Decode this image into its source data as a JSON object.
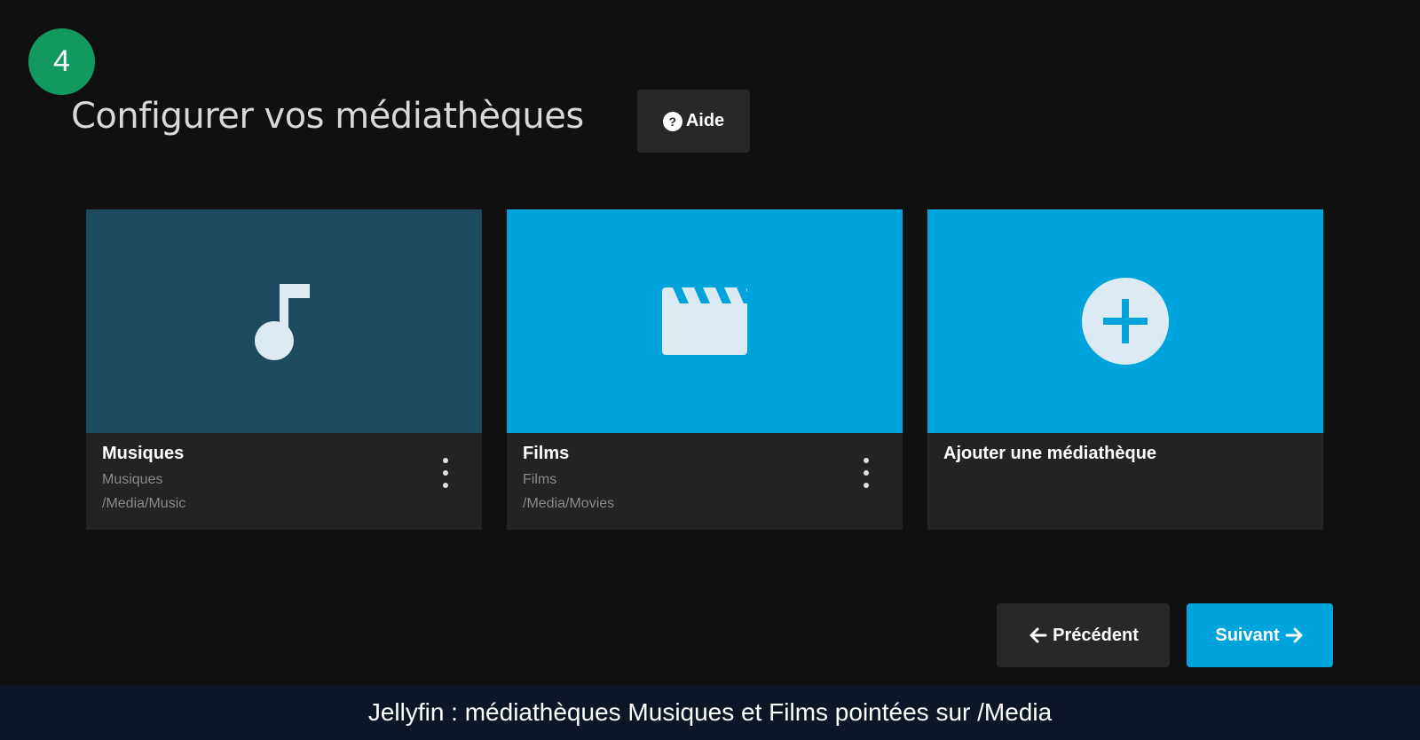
{
  "step": {
    "number": "4"
  },
  "header": {
    "title": "Configurer vos médiathèques",
    "help_label": "Aide"
  },
  "libraries": [
    {
      "name": "Musiques",
      "type": "Musiques",
      "path": "/Media/Music",
      "icon": "music-note-icon",
      "color": "#1d4a5e"
    },
    {
      "name": "Films",
      "type": "Films",
      "path": "/Media/Movies",
      "icon": "clapperboard-icon",
      "color": "#00a4dc"
    },
    {
      "name": "Ajouter une médiathèque",
      "icon": "add-circle-icon",
      "color": "#00a4dc"
    }
  ],
  "navigation": {
    "previous_label": "Précédent",
    "next_label": "Suivant"
  },
  "caption": {
    "text": "Jellyfin : médiathèques Musiques et Films pointées sur /Media"
  },
  "colors": {
    "accent": "#00a4dc",
    "badge": "#12995f",
    "background": "#101010"
  }
}
